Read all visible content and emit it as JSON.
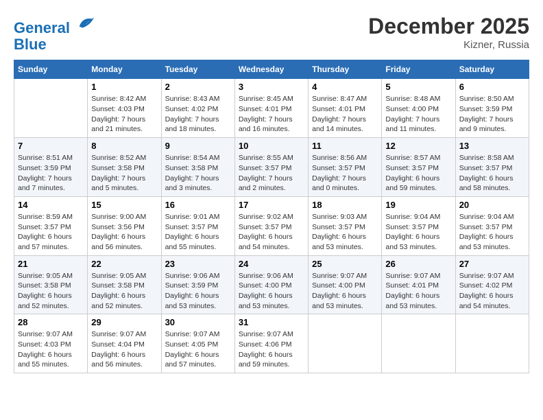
{
  "header": {
    "logo_line1": "General",
    "logo_line2": "Blue",
    "month_year": "December 2025",
    "location": "Kizner, Russia"
  },
  "days_of_week": [
    "Sunday",
    "Monday",
    "Tuesday",
    "Wednesday",
    "Thursday",
    "Friday",
    "Saturday"
  ],
  "weeks": [
    [
      {
        "day": "",
        "content": ""
      },
      {
        "day": "1",
        "content": "Sunrise: 8:42 AM\nSunset: 4:03 PM\nDaylight: 7 hours\nand 21 minutes."
      },
      {
        "day": "2",
        "content": "Sunrise: 8:43 AM\nSunset: 4:02 PM\nDaylight: 7 hours\nand 18 minutes."
      },
      {
        "day": "3",
        "content": "Sunrise: 8:45 AM\nSunset: 4:01 PM\nDaylight: 7 hours\nand 16 minutes."
      },
      {
        "day": "4",
        "content": "Sunrise: 8:47 AM\nSunset: 4:01 PM\nDaylight: 7 hours\nand 14 minutes."
      },
      {
        "day": "5",
        "content": "Sunrise: 8:48 AM\nSunset: 4:00 PM\nDaylight: 7 hours\nand 11 minutes."
      },
      {
        "day": "6",
        "content": "Sunrise: 8:50 AM\nSunset: 3:59 PM\nDaylight: 7 hours\nand 9 minutes."
      }
    ],
    [
      {
        "day": "7",
        "content": "Sunrise: 8:51 AM\nSunset: 3:59 PM\nDaylight: 7 hours\nand 7 minutes."
      },
      {
        "day": "8",
        "content": "Sunrise: 8:52 AM\nSunset: 3:58 PM\nDaylight: 7 hours\nand 5 minutes."
      },
      {
        "day": "9",
        "content": "Sunrise: 8:54 AM\nSunset: 3:58 PM\nDaylight: 7 hours\nand 3 minutes."
      },
      {
        "day": "10",
        "content": "Sunrise: 8:55 AM\nSunset: 3:57 PM\nDaylight: 7 hours\nand 2 minutes."
      },
      {
        "day": "11",
        "content": "Sunrise: 8:56 AM\nSunset: 3:57 PM\nDaylight: 7 hours\nand 0 minutes."
      },
      {
        "day": "12",
        "content": "Sunrise: 8:57 AM\nSunset: 3:57 PM\nDaylight: 6 hours\nand 59 minutes."
      },
      {
        "day": "13",
        "content": "Sunrise: 8:58 AM\nSunset: 3:57 PM\nDaylight: 6 hours\nand 58 minutes."
      }
    ],
    [
      {
        "day": "14",
        "content": "Sunrise: 8:59 AM\nSunset: 3:57 PM\nDaylight: 6 hours\nand 57 minutes."
      },
      {
        "day": "15",
        "content": "Sunrise: 9:00 AM\nSunset: 3:56 PM\nDaylight: 6 hours\nand 56 minutes."
      },
      {
        "day": "16",
        "content": "Sunrise: 9:01 AM\nSunset: 3:57 PM\nDaylight: 6 hours\nand 55 minutes."
      },
      {
        "day": "17",
        "content": "Sunrise: 9:02 AM\nSunset: 3:57 PM\nDaylight: 6 hours\nand 54 minutes."
      },
      {
        "day": "18",
        "content": "Sunrise: 9:03 AM\nSunset: 3:57 PM\nDaylight: 6 hours\nand 53 minutes."
      },
      {
        "day": "19",
        "content": "Sunrise: 9:04 AM\nSunset: 3:57 PM\nDaylight: 6 hours\nand 53 minutes."
      },
      {
        "day": "20",
        "content": "Sunrise: 9:04 AM\nSunset: 3:57 PM\nDaylight: 6 hours\nand 53 minutes."
      }
    ],
    [
      {
        "day": "21",
        "content": "Sunrise: 9:05 AM\nSunset: 3:58 PM\nDaylight: 6 hours\nand 52 minutes."
      },
      {
        "day": "22",
        "content": "Sunrise: 9:05 AM\nSunset: 3:58 PM\nDaylight: 6 hours\nand 52 minutes."
      },
      {
        "day": "23",
        "content": "Sunrise: 9:06 AM\nSunset: 3:59 PM\nDaylight: 6 hours\nand 53 minutes."
      },
      {
        "day": "24",
        "content": "Sunrise: 9:06 AM\nSunset: 4:00 PM\nDaylight: 6 hours\nand 53 minutes."
      },
      {
        "day": "25",
        "content": "Sunrise: 9:07 AM\nSunset: 4:00 PM\nDaylight: 6 hours\nand 53 minutes."
      },
      {
        "day": "26",
        "content": "Sunrise: 9:07 AM\nSunset: 4:01 PM\nDaylight: 6 hours\nand 53 minutes."
      },
      {
        "day": "27",
        "content": "Sunrise: 9:07 AM\nSunset: 4:02 PM\nDaylight: 6 hours\nand 54 minutes."
      }
    ],
    [
      {
        "day": "28",
        "content": "Sunrise: 9:07 AM\nSunset: 4:03 PM\nDaylight: 6 hours\nand 55 minutes."
      },
      {
        "day": "29",
        "content": "Sunrise: 9:07 AM\nSunset: 4:04 PM\nDaylight: 6 hours\nand 56 minutes."
      },
      {
        "day": "30",
        "content": "Sunrise: 9:07 AM\nSunset: 4:05 PM\nDaylight: 6 hours\nand 57 minutes."
      },
      {
        "day": "31",
        "content": "Sunrise: 9:07 AM\nSunset: 4:06 PM\nDaylight: 6 hours\nand 59 minutes."
      },
      {
        "day": "",
        "content": ""
      },
      {
        "day": "",
        "content": ""
      },
      {
        "day": "",
        "content": ""
      }
    ]
  ]
}
